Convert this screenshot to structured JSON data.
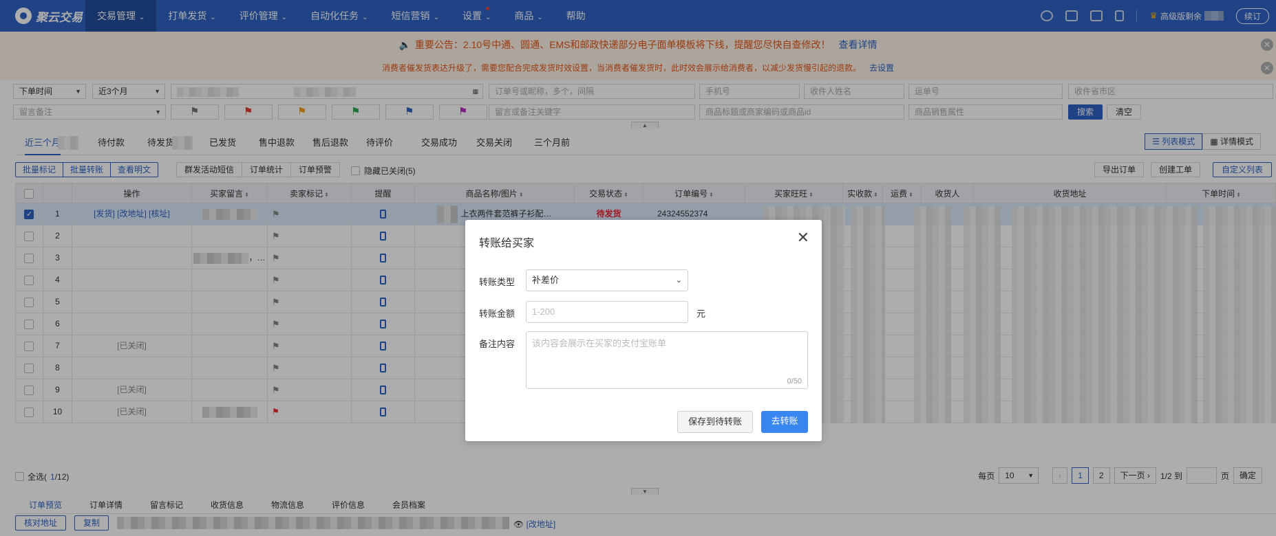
{
  "app": {
    "logo_text": "聚云交易"
  },
  "nav": [
    {
      "label": "交易管理",
      "caret": true,
      "active": true
    },
    {
      "label": "打单发货",
      "caret": true
    },
    {
      "label": "评价管理",
      "caret": true
    },
    {
      "label": "自动化任务",
      "caret": true
    },
    {
      "label": "短信营销",
      "caret": true
    },
    {
      "label": "设置",
      "caret": true,
      "dot": true
    },
    {
      "label": "商品",
      "caret": true
    },
    {
      "label": "帮助",
      "caret": false
    }
  ],
  "top_right": {
    "vip_label": "高级版剩余",
    "renew_label": "续订",
    "icons": [
      "bell-icon",
      "ticket-icon",
      "chat-icon",
      "mobile-icon"
    ]
  },
  "notice": {
    "line1": "重要公告：2.10号中通、圆通、EMS和邮政快递部分电子面单模板将下线，提醒您尽快自查修改！",
    "line1_link": "查看详情",
    "line2": "消费者催发货表达升级了，需要您配合完成发货时效设置，当消费者催发货时，此时效会展示给消费者，以减少发货慢引起的退款。",
    "line2_link": "去设置"
  },
  "filters": {
    "time_type": "下单时间",
    "range": "近3个月",
    "order_placeholder": "订单号或昵称，多个，间隔",
    "phone_placeholder": "手机号",
    "receiver_placeholder": "收件人姓名",
    "waybill_placeholder": "运单号",
    "region_placeholder": "收件省市区",
    "remark_select": "留言备注",
    "remark_placeholder": "留言或备注关键字",
    "product_placeholder": "商品标题或商家编码或商品id",
    "sale_attr_placeholder": "商品销售属性",
    "search_label": "搜索",
    "clear_label": "清空",
    "flags": [
      "#777777",
      "#e23b2e",
      "#f0a020",
      "#2ea84a",
      "#2f64c4",
      "#b52fc4"
    ]
  },
  "tabs": [
    "近三个月",
    "待付款",
    "待发货",
    "已发货",
    "售中退款",
    "售后退款",
    "待评价",
    "交易成功",
    "交易关闭",
    "三个月前"
  ],
  "view_modes": [
    "列表模式",
    "详情模式"
  ],
  "actions_left": [
    "批量标记",
    "批量转账",
    "查看明文"
  ],
  "actions_mid": [
    "群发活动短信",
    "订单统计",
    "订单预警"
  ],
  "hide_closed_label": "隐藏已关闭(5)",
  "actions_right": [
    "导出订单",
    "创建工单",
    "自定义列表"
  ],
  "columns": [
    "操作",
    "买家留言",
    "卖家标记",
    "提醒",
    "商品名称/图片",
    "交易状态",
    "订单编号",
    "买家旺旺",
    "实收款",
    "运费",
    "收货人",
    "收货地址",
    "下单时间"
  ],
  "rows": [
    {
      "n": "1",
      "op": "[发货] [改地址] [核址]",
      "product": "上衣两件套范裤子衫配…",
      "status": "待发货",
      "order_no": "24324552374"
    },
    {
      "n": "2",
      "op": ""
    },
    {
      "n": "3",
      "op": "",
      "msg_suffix": "，…"
    },
    {
      "n": "4",
      "op": ""
    },
    {
      "n": "5",
      "op": ""
    },
    {
      "n": "6",
      "op": ""
    },
    {
      "n": "7",
      "op": "[已关闭]"
    },
    {
      "n": "8",
      "op": ""
    },
    {
      "n": "9",
      "op": "[已关闭]"
    },
    {
      "n": "10",
      "op": "[已关闭]"
    }
  ],
  "footer": {
    "select_all": "全选(",
    "select_count": "1",
    "select_total": "/12)",
    "per_page_label": "每页",
    "per_page": "10",
    "pages": [
      "1",
      "2"
    ],
    "next_label": "下一页",
    "page_info": "1/2 到",
    "page_suffix": "页",
    "confirm_label": "确定"
  },
  "bottom_tabs": [
    "订单预览",
    "订单详情",
    "留言标记",
    "收货信息",
    "物流信息",
    "评价信息",
    "会员档案"
  ],
  "bottom_actions": {
    "check_address": "核对地址",
    "copy": "复制",
    "edit_address": "[改地址]"
  },
  "modal": {
    "title": "转账给买家",
    "type_label": "转账类型",
    "type_value": "补差价",
    "amount_label": "转账金额",
    "amount_placeholder": "1-200",
    "unit": "元",
    "note_label": "备注内容",
    "note_placeholder": "该内容会展示在买家的支付宝账单",
    "note_count": "0/50",
    "save_label": "保存到待转账",
    "go_label": "去转账"
  }
}
